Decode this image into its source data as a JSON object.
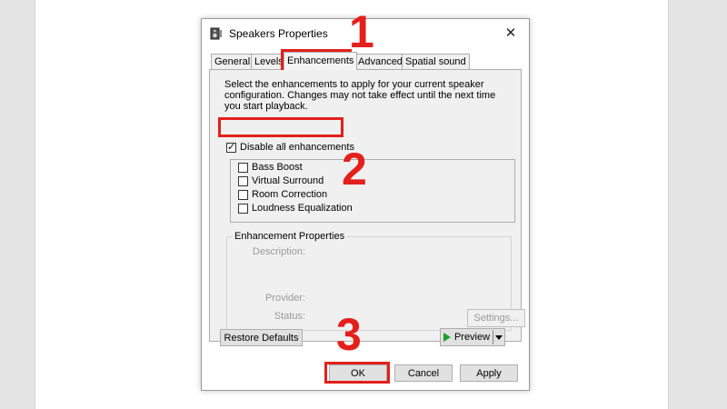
{
  "dialog": {
    "title": "Speakers Properties",
    "close_glyph": "✕",
    "tabs": [
      "General",
      "Levels",
      "Enhancements",
      "Advanced",
      "Spatial sound"
    ],
    "active_tab": "Enhancements",
    "description": "Select the enhancements to apply for your current speaker configuration. Changes may not take effect until the next time you start playback.",
    "disable_all": {
      "label": "Disable all enhancements",
      "checked": true
    },
    "enhancements": [
      {
        "label": "Bass Boost",
        "checked": false
      },
      {
        "label": "Virtual Surround",
        "checked": false
      },
      {
        "label": "Room Correction",
        "checked": false
      },
      {
        "label": "Loudness Equalization",
        "checked": false
      }
    ],
    "properties": {
      "title": "Enhancement Properties",
      "description_label": "Description:",
      "provider_label": "Provider:",
      "status_label": "Status:",
      "settings_button": "Settings..."
    },
    "restore_defaults": "Restore Defaults",
    "preview": "Preview",
    "ok": "OK",
    "cancel": "Cancel",
    "apply": "Apply"
  },
  "annotations": {
    "step1": "1",
    "step2": "2",
    "step3": "3",
    "highlight_color": "#e3201b"
  }
}
